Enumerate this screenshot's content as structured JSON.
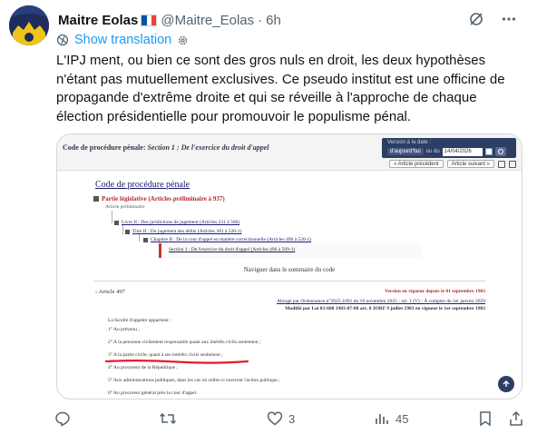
{
  "tweet": {
    "author_name": "Maitre Eolas",
    "handle": "@Maitre_Eolas",
    "separator": "·",
    "time": "6h",
    "show_translation": "Show translation",
    "text": "L'IPJ ment, ou bien ce sont des gros nuls en droit, les deux hypothèses n'étant pas mutuellement exclusives. Ce pseudo institut est une officine de propagande d'extrême droite et qui se réveille à l'approche de chaque élection présidentielle pour promouvoir le populisme pénal."
  },
  "flag_colors": [
    "#0055a4",
    "#ffffff",
    "#ef4135"
  ],
  "actions": {
    "reply_count": "",
    "retweet_count": "",
    "like_count": "3",
    "views_count": "45"
  },
  "embedded": {
    "header_prefix": "Code de procédure pénale:",
    "header_section": "Section 1 : De l'exercice du droit d'appel",
    "date_label": "Version à la date :",
    "today_btn": "d'aujourd'hui",
    "date_or": "ou du",
    "date_value": "14/04/2026",
    "prev_btn": "« Article précédent",
    "next_btn": "Article suivant »",
    "code_title": "Code de procédure pénale",
    "partie": "Partie législative (Articles préliminaire à 937)",
    "prelim": "Article préliminaire",
    "livre": "Livre II : Des juridictions de jugement (Articles 231 à 566)",
    "titre": "Titre II : Du jugement des délits (Articles 381 à 520-1)",
    "chapitre": "Chapitre II : De la cour d'appel en matière correctionnelle (Articles 496 à 520-1)",
    "section": "Section 1 : De l'exercice du droit d'appel (Articles 496 à 509-1)",
    "nav_summary": "Naviguer dans le sommaire du code",
    "article": "Article 497",
    "vigueur": "Version en vigueur depuis le 01 septembre 1983",
    "abroge": "Abrogé par Ordonnance n°2025-1091 du 19 novembre 2025 - art. 1 (V) - À compter du 1er janvier 2029",
    "modifie": "Modifié par Loi 83-608 1983-07-08 art. 8 JORF 9 juillet 1983 en vigueur le 1er septembre 1983",
    "lines": [
      "La faculté d'appeler appartient :",
      "1° Au prévenu ;",
      "2° A la personne civilement responsable quant aux intérêts civils seulement ;",
      "3° A la partie civile, quant à ses intérêts civils seulement ;",
      "4° Au procureur de la République ;",
      "5° Aux administrations publiques, dans les cas où celles-ci exercent l'action publique ;",
      "6° Au procureur général près la cour d'appel."
    ],
    "highlight_color": "#e8192c"
  }
}
